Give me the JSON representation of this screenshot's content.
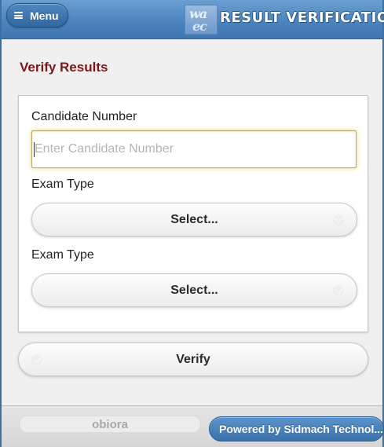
{
  "header": {
    "menu_label": "Menu",
    "brand_title": "RESULT VERIFICATION",
    "logo_text_top": "wa",
    "logo_text_bottom": "ec",
    "colors": {
      "header_bg": "#4a82bd",
      "brand_text": "#ffffff"
    }
  },
  "page": {
    "title": "Verify Results",
    "title_color": "#7a1818"
  },
  "form": {
    "candidate_label": "Candidate Number",
    "candidate_value": "",
    "candidate_placeholder": "Enter Candidate Number",
    "exam_type_label_1": "Exam Type",
    "exam_type_select_1": "Select...",
    "exam_type_label_2": "Exam Type",
    "exam_type_select_2": "Select...",
    "verify_label": "Verify"
  },
  "footer": {
    "username": "obiora",
    "powered_by": "Powered by Sidmach Technol..."
  },
  "icons": {
    "menu": "hamburger-icon",
    "select_chevron": "chevron-down-icon",
    "verify": "check-icon"
  }
}
